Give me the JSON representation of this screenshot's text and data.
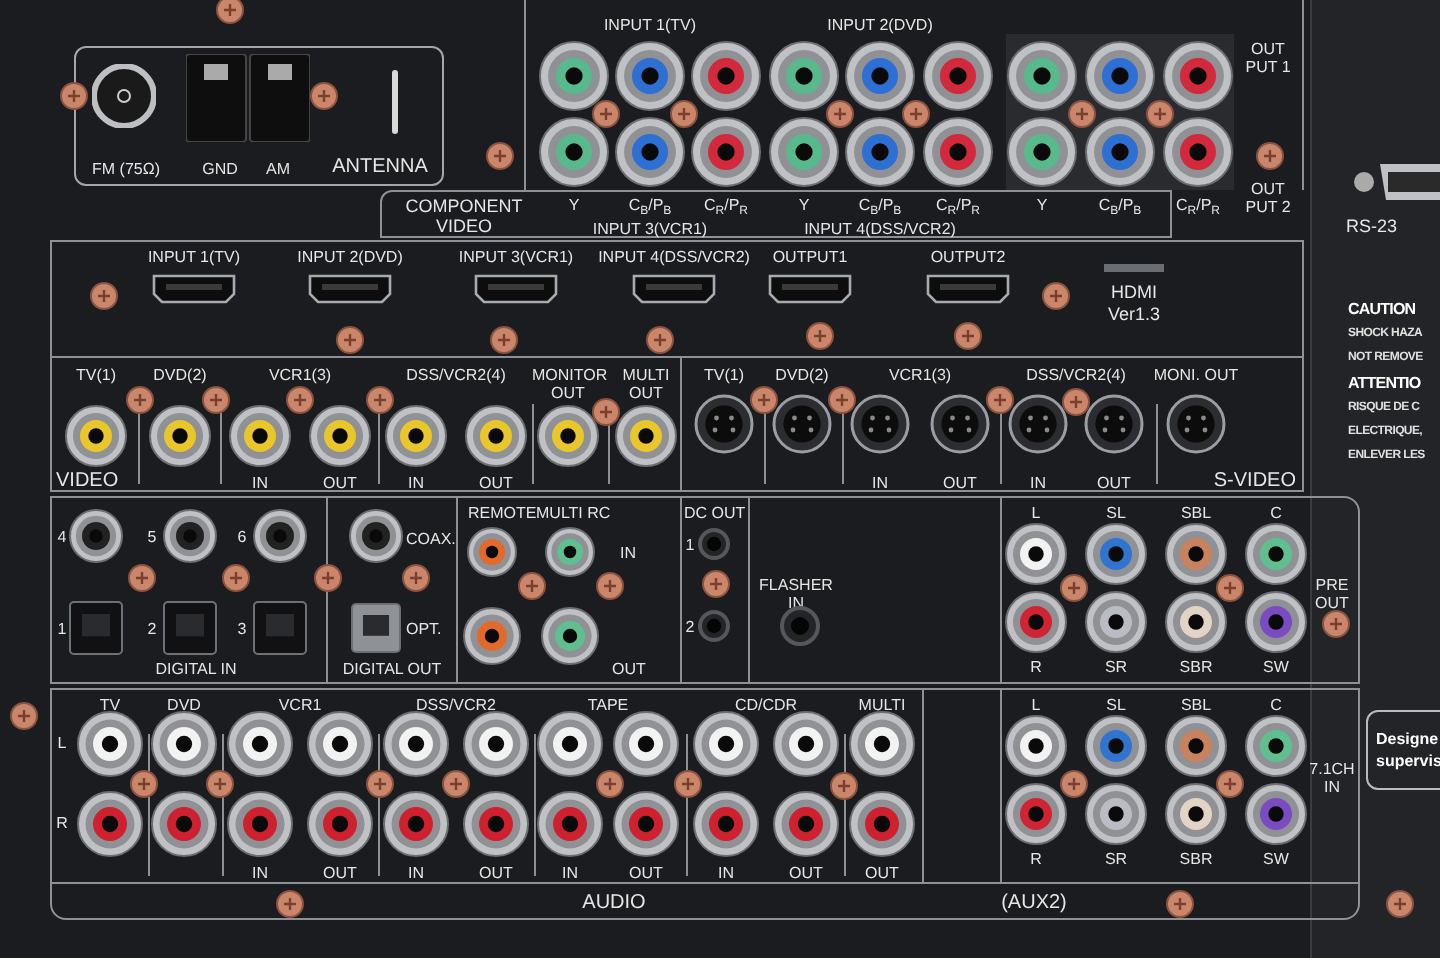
{
  "antenna": {
    "title": "ANTENNA",
    "terminals": [
      "FM (75Ω)",
      "GND",
      "AM"
    ]
  },
  "component_video": {
    "title": "COMPONENT VIDEO",
    "inputs_top": [
      "INPUT 1(TV)",
      "INPUT 2(DVD)"
    ],
    "inputs_bottom": [
      "INPUT 3(VCR1)",
      "INPUT 4(DSS/VCR2)"
    ],
    "columns": [
      {
        "label": "Y",
        "color": "#57b98c"
      },
      {
        "label": "C$_{B}$/P$_{B}$",
        "color": "#2d6fd3"
      },
      {
        "label": "C$_{R}$/P$_{R}$",
        "color": "#d3293c"
      },
      {
        "label": "Y",
        "color": "#57b98c"
      },
      {
        "label": "C$_{B}$/P$_{B}$",
        "color": "#2d6fd3"
      },
      {
        "label": "C$_{R}$/P$_{R}$",
        "color": "#d3293c"
      },
      {
        "label": "Y",
        "color": "#57b98c"
      },
      {
        "label": "C$_{B}$/P$_{B}$",
        "color": "#2d6fd3"
      },
      {
        "label": "C$_{R}$/P$_{R}$",
        "color": "#d3293c"
      }
    ],
    "outputs": [
      "OUT PUT 1",
      "OUT PUT 2"
    ]
  },
  "hdmi": {
    "ports": [
      "INPUT 1(TV)",
      "INPUT 2(DVD)",
      "INPUT 3(VCR1)",
      "INPUT 4(DSS/VCR2)",
      "OUTPUT1",
      "OUTPUT2"
    ],
    "badge": [
      "HDMI",
      "Ver1.3"
    ]
  },
  "video": {
    "title": "VIDEO",
    "groups": [
      {
        "label": "TV(1)",
        "kind": "single"
      },
      {
        "label": "DVD(2)",
        "kind": "single"
      },
      {
        "label": "VCR1(3)",
        "kind": "pair",
        "captions": [
          "IN",
          "OUT"
        ]
      },
      {
        "label": "DSS/VCR2(4)",
        "kind": "pair",
        "captions": [
          "IN",
          "OUT"
        ]
      },
      {
        "label": "MONITOR OUT",
        "kind": "single"
      },
      {
        "label": "MULTI OUT",
        "kind": "single"
      }
    ]
  },
  "s_video": {
    "title": "S-VIDEO",
    "groups": [
      {
        "label": "TV(1)",
        "kind": "single"
      },
      {
        "label": "DVD(2)",
        "kind": "single"
      },
      {
        "label": "VCR1(3)",
        "kind": "pair",
        "captions": [
          "IN",
          "OUT"
        ]
      },
      {
        "label": "DSS/VCR2(4)",
        "kind": "pair",
        "captions": [
          "IN",
          "OUT"
        ]
      },
      {
        "label": "MONI. OUT",
        "kind": "single"
      }
    ]
  },
  "digital": {
    "in_title": "DIGITAL IN",
    "coax": [
      "4",
      "5",
      "6"
    ],
    "optical": [
      "1",
      "2",
      "3"
    ],
    "out_title": "DIGITAL OUT",
    "out_labels": [
      "COAX.",
      "OPT."
    ]
  },
  "remote": {
    "labels": [
      "REMOTE",
      "MULTI RC"
    ],
    "in": "IN",
    "out": "OUT"
  },
  "dc_out": {
    "title": "DC OUT",
    "ports": [
      "1",
      "2"
    ]
  },
  "flasher": {
    "label": "FLASHER IN"
  },
  "pre_out": {
    "title": "PRE OUT",
    "top": [
      {
        "label": "L",
        "color": "#f2f2f2"
      },
      {
        "label": "SL",
        "color": "#2f74d0"
      },
      {
        "label": "SBL",
        "color": "#c9825e"
      },
      {
        "label": "C",
        "color": "#5fbf8e"
      }
    ],
    "bottom": [
      {
        "label": "R",
        "color": "#d02433"
      },
      {
        "label": "SR",
        "color": "#b9bcc2"
      },
      {
        "label": "SBR",
        "color": "#e3d3c4"
      },
      {
        "label": "SW",
        "color": "#7b4bc4"
      }
    ]
  },
  "audio": {
    "title": "AUDIO",
    "rows": [
      "L",
      "R"
    ],
    "groups": [
      {
        "label": "TV",
        "kind": "single"
      },
      {
        "label": "DVD",
        "kind": "single"
      },
      {
        "label": "VCR1",
        "kind": "pair",
        "captions": [
          "IN",
          "OUT"
        ]
      },
      {
        "label": "DSS/VCR2",
        "kind": "pair",
        "captions": [
          "IN",
          "OUT"
        ]
      },
      {
        "label": "TAPE",
        "kind": "pair",
        "captions": [
          "IN",
          "OUT"
        ]
      },
      {
        "label": "CD/CDR",
        "kind": "pair",
        "captions": [
          "IN",
          "OUT"
        ]
      },
      {
        "label": "MULTI",
        "kind": "single",
        "captions": [
          "OUT"
        ]
      }
    ]
  },
  "ch71_in": {
    "title": "7.1CH IN",
    "footer": "(AUX2)",
    "top": [
      {
        "label": "L",
        "color": "#f2f2f2"
      },
      {
        "label": "SL",
        "color": "#2f74d0"
      },
      {
        "label": "SBL",
        "color": "#c9825e"
      },
      {
        "label": "C",
        "color": "#5fbf8e"
      }
    ],
    "bottom": [
      {
        "label": "R",
        "color": "#d02433"
      },
      {
        "label": "SR",
        "color": "#b9bcc2"
      },
      {
        "label": "SBR",
        "color": "#e3d3c4"
      },
      {
        "label": "SW",
        "color": "#7b4bc4"
      }
    ]
  },
  "side": {
    "port": "RS-23",
    "caution": [
      {
        "text": "CAUTION",
        "kind": "heading"
      },
      {
        "text": "SHOCK HAZA",
        "kind": "line"
      },
      {
        "text": "NOT REMOVE",
        "kind": "line"
      },
      {
        "text": "ATTENTIO",
        "kind": "heading"
      },
      {
        "text": "RISQUE DE C",
        "kind": "line"
      },
      {
        "text": "ELECTRIQUE,",
        "kind": "line"
      },
      {
        "text": "ENLEVER LES",
        "kind": "line"
      }
    ],
    "plate": [
      "Designe",
      "supervis"
    ]
  }
}
